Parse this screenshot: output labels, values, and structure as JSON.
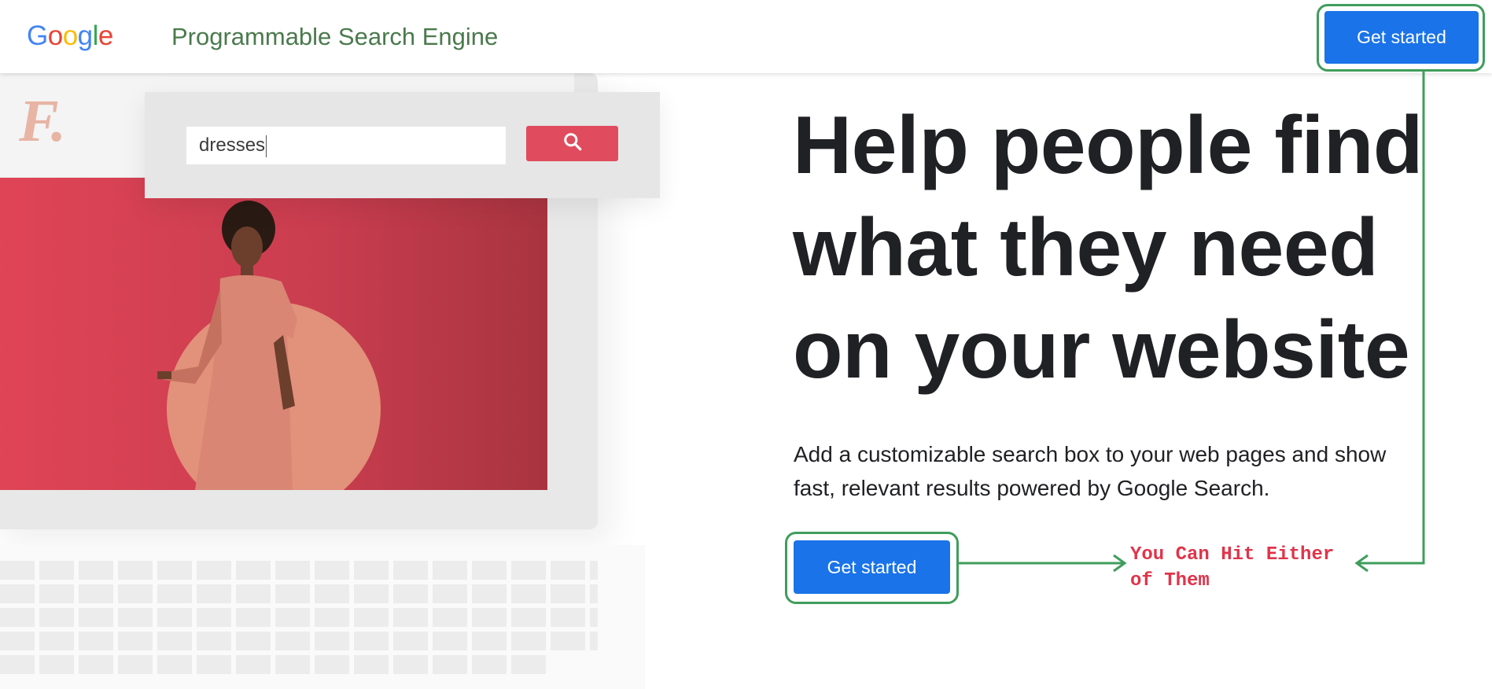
{
  "header": {
    "logo_letters": [
      {
        "char": "G",
        "color": "#4285F4"
      },
      {
        "char": "o",
        "color": "#EA4335"
      },
      {
        "char": "o",
        "color": "#FBBC05"
      },
      {
        "char": "g",
        "color": "#4285F4"
      },
      {
        "char": "l",
        "color": "#34A853"
      },
      {
        "char": "e",
        "color": "#EA4335"
      }
    ],
    "product_name": "Programmable Search Engine",
    "cta_label": "Get started"
  },
  "illustration": {
    "brand_letter": "F.",
    "search_value": "dresses",
    "search_icon": "search-icon"
  },
  "hero": {
    "headline": "Help people find what they need on your website",
    "subtext": "Add a customizable search box to your web pages and show fast, relevant results powered by Google Search.",
    "cta_label": "Get started"
  },
  "annotation": {
    "line1": "You Can Hit Either",
    "line2": "of Them",
    "highlight_color": "#3f9d5c",
    "text_color": "#e0344a"
  },
  "colors": {
    "primary_button": "#1a73e8",
    "accent_red": "#e04b5e"
  }
}
